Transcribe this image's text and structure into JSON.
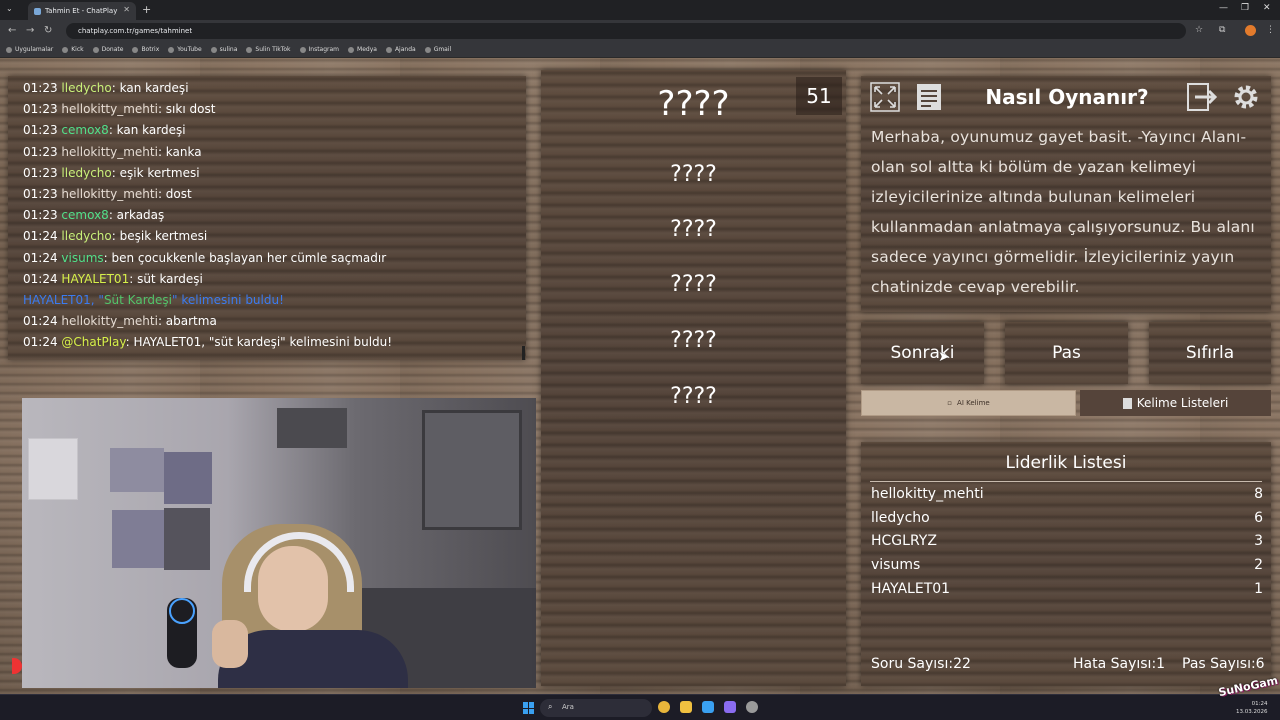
{
  "browser": {
    "tab_title": "Tahmin Et - ChatPlay",
    "url": "chatplay.com.tr/games/tahminet",
    "bookmarks": [
      "Uygulamalar",
      "Kick",
      "Donate",
      "Botrix",
      "YouTube",
      "sulina",
      "Sulin TikTok",
      "Instagram",
      "Medya",
      "Ajanda",
      "Gmail"
    ]
  },
  "chat": {
    "lines": [
      {
        "time": "01:23",
        "user": "lledycho",
        "user_color": "#c9f07a",
        "msg": "kan kardeşi"
      },
      {
        "time": "01:23",
        "user": "hellokitty_mehti",
        "user_color": "#e6dcd3",
        "msg": "sıkı dost"
      },
      {
        "time": "01:23",
        "user": "cemox8",
        "user_color": "#52e08a",
        "msg": "kan kardeşi"
      },
      {
        "time": "01:23",
        "user": "hellokitty_mehti",
        "user_color": "#e6dcd3",
        "msg": "kanka"
      },
      {
        "time": "01:23",
        "user": "lledycho",
        "user_color": "#c9f07a",
        "msg": "eşik kertmesi"
      },
      {
        "time": "01:23",
        "user": "hellokitty_mehti",
        "user_color": "#e6dcd3",
        "msg": "dost"
      },
      {
        "time": "01:23",
        "user": "cemox8",
        "user_color": "#52e08a",
        "msg": "arkadaş"
      },
      {
        "time": "01:24",
        "user": "lledycho",
        "user_color": "#c9f07a",
        "msg": "beşik kertmesi"
      },
      {
        "time": "01:24",
        "user": "visums",
        "user_color": "#52e08a",
        "msg": "ben çocukkenle başlayan her cümle saçmadır"
      },
      {
        "time": "01:24",
        "user": "HAYALET01",
        "user_color": "#d6f04a",
        "msg": "süt kardeşi"
      }
    ],
    "found_notice": {
      "user": "HAYALET01",
      "sep": ", \"",
      "word": "Süt Kardeşi",
      "suffix": "\" kelimesini buldu!"
    },
    "after_lines": [
      {
        "time": "01:24",
        "user": "hellokitty_mehti",
        "user_color": "#e6dcd3",
        "msg": "abartma"
      },
      {
        "time": "01:24",
        "user": "@ChatPlay",
        "user_color": "#d6f04a",
        "msg": "HAYALET01, \"süt kardeşi\" kelimesini buldu!"
      }
    ]
  },
  "words": {
    "counter": "51",
    "items": [
      "????",
      "????",
      "????",
      "????",
      "????",
      "????"
    ]
  },
  "howto": {
    "title": "Nasıl Oynanır?",
    "text": "Merhaba, oyunumuz gayet basit. -Yayıncı Alanı- olan sol altta ki bölüm de yazan kelimeyi izleyicilerinize altında bulunan kelimeleri kullanmadan anlatmaya çalışıyorsunuz. Bu alanı sadece yayıncı görmelidir. İzleyicileriniz yayın chatinizde cevap verebilir."
  },
  "actions": {
    "next": "Sonraki",
    "pass": "Pas",
    "reset": "Sıfırla"
  },
  "tabs": {
    "ai": "AI Kelime",
    "lists": "Kelime Listeleri"
  },
  "leaderboard": {
    "title": "Liderlik Listesi",
    "rows": [
      {
        "name": "hellokitty_mehti",
        "score": "8"
      },
      {
        "name": "lledycho",
        "score": "6"
      },
      {
        "name": "HCGLRYZ",
        "score": "3"
      },
      {
        "name": "visums",
        "score": "2"
      },
      {
        "name": "HAYALET01",
        "score": "1"
      }
    ]
  },
  "stats": {
    "questions": "Soru Sayısı:22",
    "errors": "Hata Sayısı:1",
    "passes": "Pas Sayısı:6"
  },
  "taskbar": {
    "search_placeholder": "Ara",
    "time": "01:24",
    "date": "13.03.2026"
  },
  "watermark": "SuNoGam",
  "colors": {
    "notice_blue": "#3b7bf0",
    "notice_green": "#52c46a"
  }
}
